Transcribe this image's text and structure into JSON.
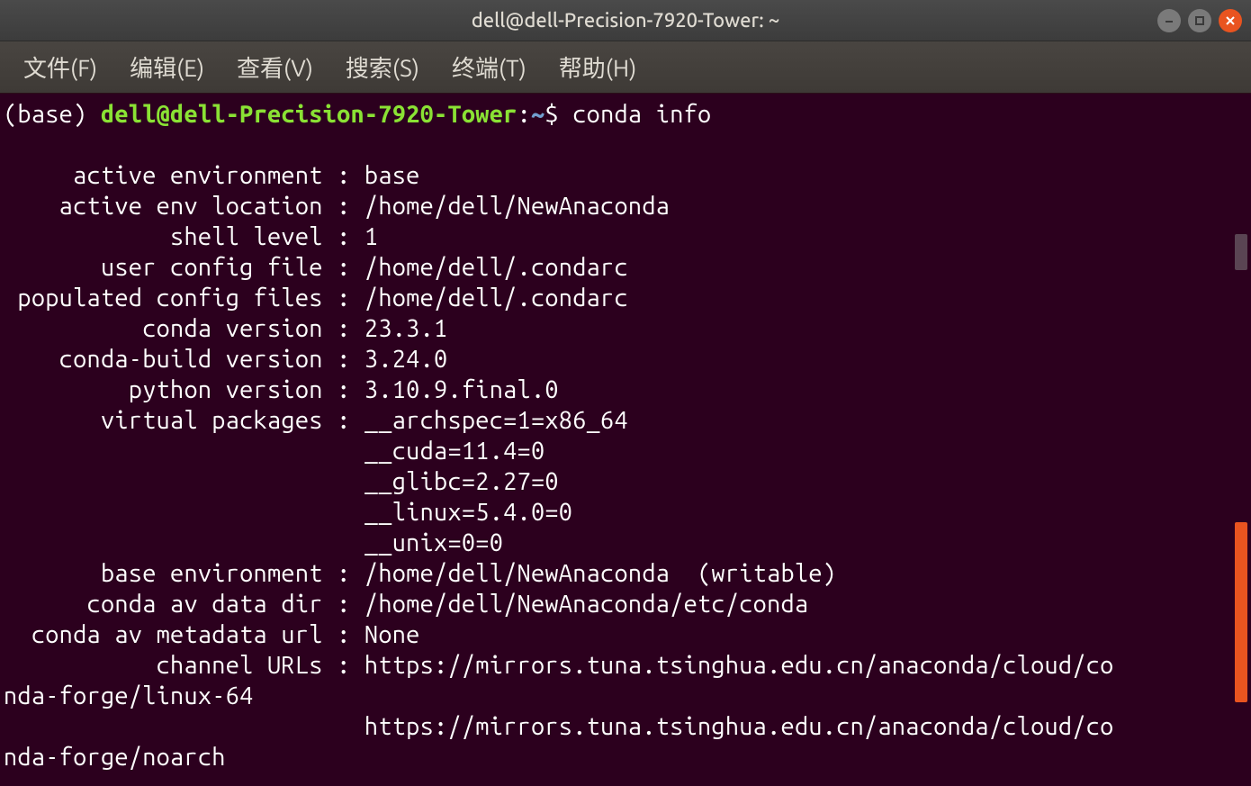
{
  "titlebar": {
    "title": "dell@dell-Precision-7920-Tower: ~"
  },
  "menus": {
    "file": "文件(F)",
    "edit": "编辑(E)",
    "view": "查看(V)",
    "search": "搜索(S)",
    "terminal": "终端(T)",
    "help": "帮助(H)"
  },
  "prompt": {
    "env": "(base) ",
    "userhost": "dell@dell-Precision-7920-Tower",
    "colon": ":",
    "path": "~",
    "dollar": "$ ",
    "command": "conda info"
  },
  "info": {
    "labels": {
      "active_env": "     active environment : ",
      "active_env_loc": "    active env location : ",
      "shell_level": "            shell level : ",
      "user_config": "       user config file : ",
      "pop_config": " populated config files : ",
      "conda_version": "          conda version : ",
      "conda_build": "    conda-build version : ",
      "python_version": "         python version : ",
      "virtual_packages": "       virtual packages : ",
      "vp_pad": "                          ",
      "base_env": "       base environment : ",
      "av_data_dir": "      conda av data dir : ",
      "av_meta_url": "  conda av metadata url : ",
      "channel_urls": "           channel URLs : "
    },
    "values": {
      "active_env": "base",
      "active_env_loc": "/home/dell/NewAnaconda",
      "shell_level": "1",
      "user_config": "/home/dell/.condarc",
      "pop_config": "/home/dell/.condarc",
      "conda_version": "23.3.1",
      "conda_build": "3.24.0",
      "python_version": "3.10.9.final.0",
      "vp1": "__archspec=1=x86_64",
      "vp2": "__cuda=11.4=0",
      "vp3": "__glibc=2.27=0",
      "vp4": "__linux=5.4.0=0",
      "vp5": "__unix=0=0",
      "base_env": "/home/dell/NewAnaconda  (writable)",
      "av_data_dir": "/home/dell/NewAnaconda/etc/conda",
      "av_meta_url": "None",
      "ch1a": "https://mirrors.tuna.tsinghua.edu.cn/anaconda/cloud/co",
      "ch1b": "nda-forge/linux-64",
      "ch2a": "https://mirrors.tuna.tsinghua.edu.cn/anaconda/cloud/co",
      "ch2b": "nda-forge/noarch"
    }
  }
}
